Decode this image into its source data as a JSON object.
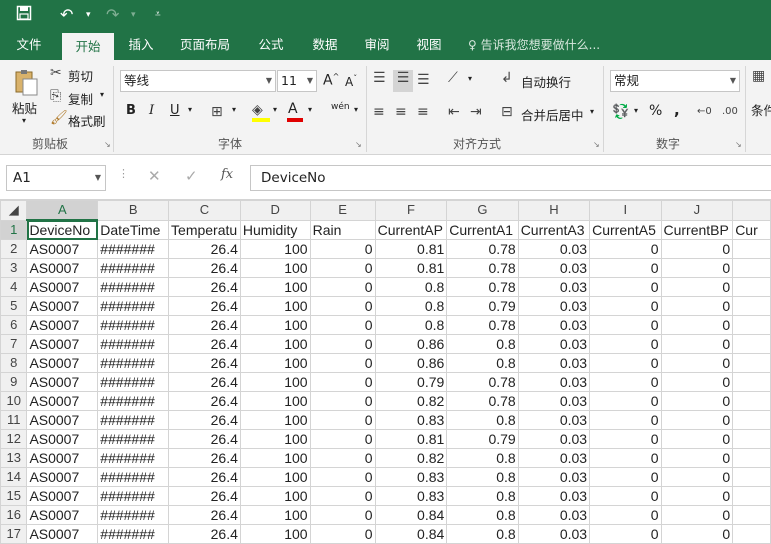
{
  "qat": {
    "save_icon": "save-icon",
    "undo_icon": "undo-icon",
    "redo_icon": "redo-icon",
    "customize_icon": "customize-icon"
  },
  "tabs": [
    "文件",
    "开始",
    "插入",
    "页面布局",
    "公式",
    "数据",
    "审阅",
    "视图"
  ],
  "tell_me": "告诉我您想要做什么...",
  "ribbon": {
    "clipboard": {
      "paste": "粘贴",
      "cut": "剪切",
      "copy": "复制",
      "format_painter": "格式刷",
      "label": "剪贴板"
    },
    "font": {
      "name": "等线",
      "size": "11",
      "label": "字体",
      "bold": "B",
      "italic": "I",
      "underline": "U",
      "grow": "A",
      "shrink": "A",
      "phonetic": "wén"
    },
    "alignment": {
      "wrap": "自动换行",
      "merge": "合并后居中",
      "label": "对齐方式"
    },
    "number": {
      "format": "常规",
      "label": "数字",
      "percent": "%",
      "comma": ","
    },
    "styles": {
      "cond": "条件"
    }
  },
  "formula_bar": {
    "name_box": "A1",
    "fx": "fx",
    "content": "DeviceNo"
  },
  "sheet": {
    "columns": [
      "A",
      "B",
      "C",
      "D",
      "E",
      "F",
      "G",
      "H",
      "I",
      "J",
      ""
    ],
    "rows": [
      [
        "DeviceNo",
        "DateTime",
        "Temperatu",
        "Humidity",
        "Rain",
        "CurrentAP",
        "CurrentA1",
        "CurrentA3",
        "CurrentA5",
        "CurrentBP",
        "Cur"
      ],
      [
        "AS0007",
        "#######",
        "26.4",
        "100",
        "0",
        "0.81",
        "0.78",
        "0.03",
        "0",
        "0",
        ""
      ],
      [
        "AS0007",
        "#######",
        "26.4",
        "100",
        "0",
        "0.81",
        "0.78",
        "0.03",
        "0",
        "0",
        ""
      ],
      [
        "AS0007",
        "#######",
        "26.4",
        "100",
        "0",
        "0.8",
        "0.78",
        "0.03",
        "0",
        "0",
        ""
      ],
      [
        "AS0007",
        "#######",
        "26.4",
        "100",
        "0",
        "0.8",
        "0.79",
        "0.03",
        "0",
        "0",
        ""
      ],
      [
        "AS0007",
        "#######",
        "26.4",
        "100",
        "0",
        "0.8",
        "0.78",
        "0.03",
        "0",
        "0",
        ""
      ],
      [
        "AS0007",
        "#######",
        "26.4",
        "100",
        "0",
        "0.86",
        "0.8",
        "0.03",
        "0",
        "0",
        ""
      ],
      [
        "AS0007",
        "#######",
        "26.4",
        "100",
        "0",
        "0.86",
        "0.8",
        "0.03",
        "0",
        "0",
        ""
      ],
      [
        "AS0007",
        "#######",
        "26.4",
        "100",
        "0",
        "0.79",
        "0.78",
        "0.03",
        "0",
        "0",
        ""
      ],
      [
        "AS0007",
        "#######",
        "26.4",
        "100",
        "0",
        "0.82",
        "0.78",
        "0.03",
        "0",
        "0",
        ""
      ],
      [
        "AS0007",
        "#######",
        "26.4",
        "100",
        "0",
        "0.83",
        "0.8",
        "0.03",
        "0",
        "0",
        ""
      ],
      [
        "AS0007",
        "#######",
        "26.4",
        "100",
        "0",
        "0.81",
        "0.79",
        "0.03",
        "0",
        "0",
        ""
      ],
      [
        "AS0007",
        "#######",
        "26.4",
        "100",
        "0",
        "0.82",
        "0.8",
        "0.03",
        "0",
        "0",
        ""
      ],
      [
        "AS0007",
        "#######",
        "26.4",
        "100",
        "0",
        "0.83",
        "0.8",
        "0.03",
        "0",
        "0",
        ""
      ],
      [
        "AS0007",
        "#######",
        "26.4",
        "100",
        "0",
        "0.83",
        "0.8",
        "0.03",
        "0",
        "0",
        ""
      ],
      [
        "AS0007",
        "#######",
        "26.4",
        "100",
        "0",
        "0.84",
        "0.8",
        "0.03",
        "0",
        "0",
        ""
      ],
      [
        "AS0007",
        "#######",
        "26.4",
        "100",
        "0",
        "0.84",
        "0.8",
        "0.03",
        "0",
        "0",
        ""
      ]
    ]
  }
}
